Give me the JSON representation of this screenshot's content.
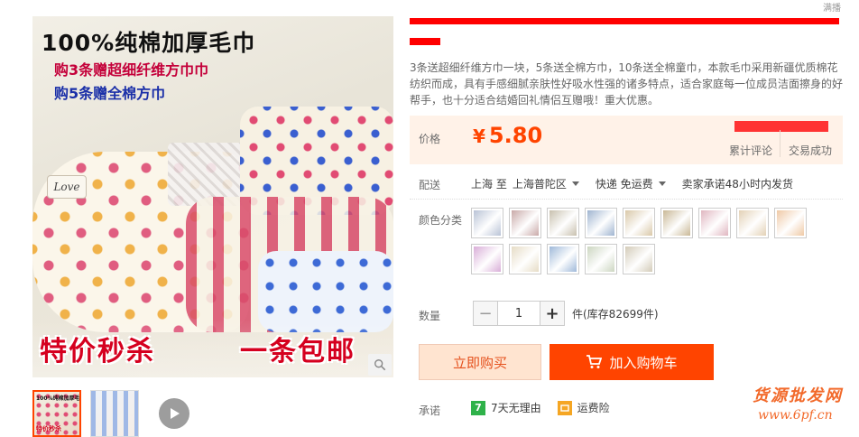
{
  "gallery": {
    "promo_title": "100%纯棉加厚毛巾",
    "promo_line1": "购3条赠超细纤维方巾巾",
    "promo_line2": "购5条赠全棉方巾",
    "tag": "Love",
    "sale_left": "特价秒杀",
    "sale_right": "一条包邮",
    "thumb_mini_title": "100%纯棉加厚毛巾",
    "thumb_mini_sale": "特价秒杀"
  },
  "product": {
    "top_right": "满播",
    "subtitle": "3条送超细纤维方巾一块，5条送全棉方巾，10条送全棉童巾，本款毛巾采用新疆优质棉花纺织而成，具有手感细腻亲肤性好吸水性强的诸多特点，适合家庭每一位成员洁面擦身的好帮手，也十分适合结婚回礼情侣互赠哦！重大优惠。",
    "price_label": "价格",
    "currency": "¥",
    "price": "5.80",
    "stat1_label": "累计评论",
    "stat2_label": "交易成功"
  },
  "shipping": {
    "label": "配送",
    "from": "上海 至",
    "to": "上海普陀区",
    "method": "快递 免运费",
    "promise": "卖家承诺48小时内发货"
  },
  "colors": {
    "label": "颜色分类",
    "swatch_colors": [
      "#b9c3d6",
      "#c9a9a8",
      "#c8c0ae",
      "#9fb4d0",
      "#d9c8a8",
      "#c9b896",
      "#e0b6c0",
      "#e3d1b5",
      "#efc9a5",
      "#d9aed8",
      "#e6dcc6",
      "#9fb9d9",
      "#ccd6c1",
      "#d3cbb8"
    ]
  },
  "quantity": {
    "label": "数量",
    "minus": "−",
    "plus": "+",
    "value": "1",
    "stock_text": "件(库存82699件)"
  },
  "actions": {
    "buy_now": "立即购买",
    "add_cart": "加入购物车"
  },
  "promise": {
    "label": "承诺",
    "badge7": "7",
    "item1": "7天无理由",
    "item2": "运费险"
  },
  "watermark": {
    "line1": "货源批发网",
    "line2": "www.6pf.cn"
  },
  "colors_theme": {
    "accent": "#ff4400",
    "price_bg": "#fff2e8"
  }
}
